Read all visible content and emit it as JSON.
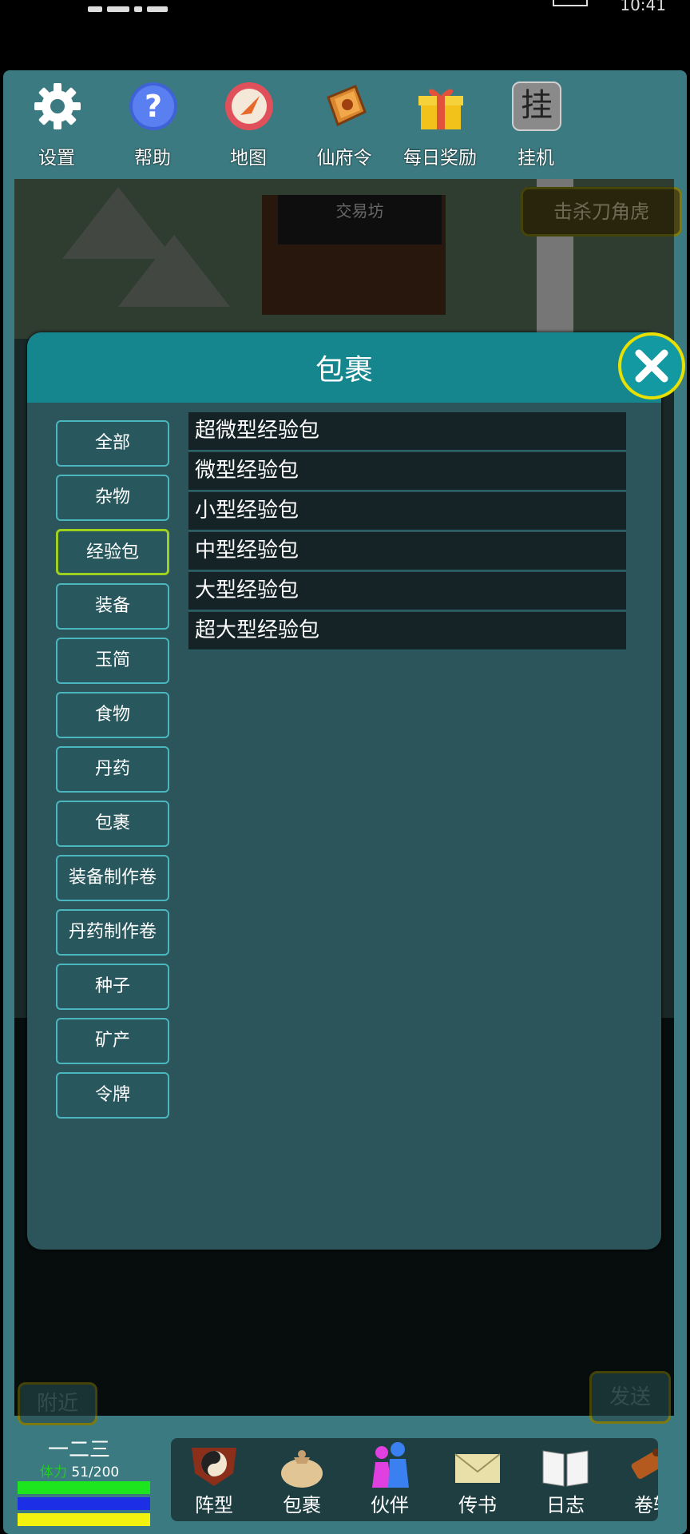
{
  "status_bar": {
    "time": "10:41"
  },
  "toolbar": [
    {
      "label": "设置",
      "icon": "gear-icon"
    },
    {
      "label": "帮助",
      "icon": "help-icon"
    },
    {
      "label": "地图",
      "icon": "compass-icon"
    },
    {
      "label": "仙府令",
      "icon": "token-icon"
    },
    {
      "label": "每日奖励",
      "icon": "gift-icon"
    },
    {
      "label": "挂机",
      "icon": "idle-icon"
    }
  ],
  "toolbar_idle_glyph": "挂",
  "scene": {
    "shop_label": "交易坊",
    "quest_button": "击杀刀角虎",
    "nearby_button": "附近",
    "send_button": "发送"
  },
  "dialog": {
    "title": "包裹",
    "categories": [
      "全部",
      "杂物",
      "经验包",
      "装备",
      "玉简",
      "食物",
      "丹药",
      "包裹",
      "装备制作卷",
      "丹药制作卷",
      "种子",
      "矿产",
      "令牌"
    ],
    "selected_category": "经验包",
    "items": [
      "超微型经验包",
      "微型经验包",
      "小型经验包",
      "中型经验包",
      "大型经验包",
      "超大型经验包"
    ]
  },
  "player": {
    "name": "一二三",
    "stamina_label": "体力",
    "stamina_value": "51/200",
    "bar_colors": [
      "#1ee61e",
      "#1c2ee6",
      "#f2f20e"
    ]
  },
  "bottom_nav": [
    {
      "label": "阵型",
      "icon": "formation-icon"
    },
    {
      "label": "包裹",
      "icon": "bag-icon"
    },
    {
      "label": "伙伴",
      "icon": "partners-icon"
    },
    {
      "label": "传书",
      "icon": "mail-icon"
    },
    {
      "label": "日志",
      "icon": "log-icon"
    },
    {
      "label": "卷轴",
      "icon": "scroll-icon"
    }
  ]
}
